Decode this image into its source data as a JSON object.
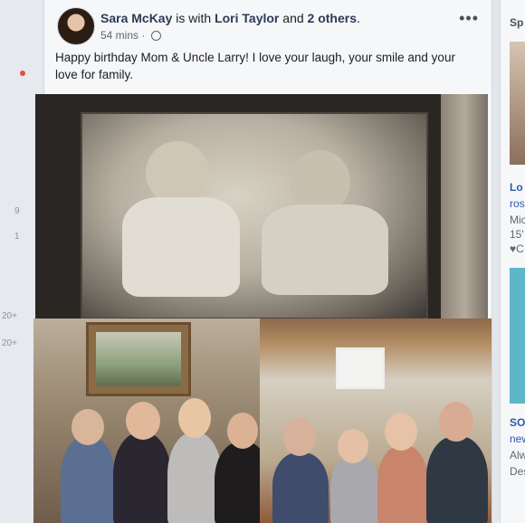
{
  "left_rail": {
    "counts": [
      "9",
      "1",
      "20+",
      "20+"
    ]
  },
  "post": {
    "author": "Sara McKay",
    "with_text": " is with ",
    "tagged_first": "Lori Taylor",
    "and_text": " and ",
    "tagged_others": "2 others",
    "period": ".",
    "time": "54 mins",
    "dot": " · ",
    "more_label": "•••",
    "text": "Happy birthday Mom & Uncle Larry! I love your laugh, your smile and your love for family."
  },
  "right_column": {
    "header": "Sp",
    "item1_title": "Lo",
    "item1_line1": "ros",
    "item1_line2": "Mic",
    "item1_line3": "15'",
    "item1_line4": "♥C",
    "item2_title": "SO",
    "item2_line1": "new",
    "item2_line2": "Alw",
    "item2_line3": "Des"
  }
}
